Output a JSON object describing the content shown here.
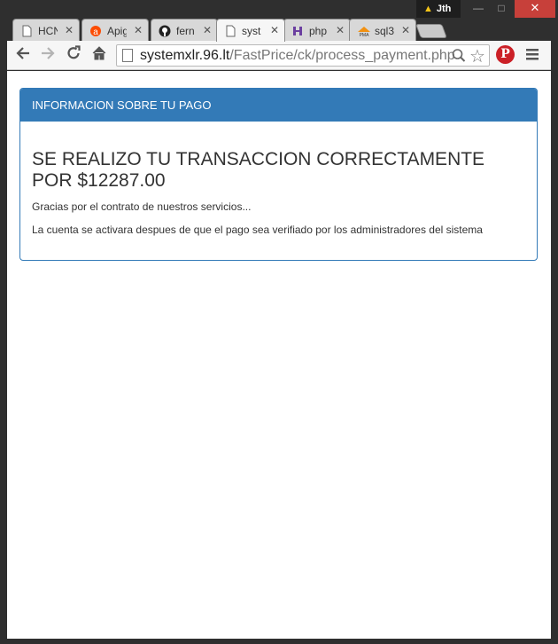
{
  "window": {
    "profile_name": "Jth",
    "min_label": "—",
    "max_label": "□",
    "close_label": "✕"
  },
  "tabs": [
    {
      "label": "HCN",
      "icon": "document-icon",
      "active": false
    },
    {
      "label": "Apig",
      "icon": "apigee-icon",
      "active": false
    },
    {
      "label": "fern",
      "icon": "github-icon",
      "active": false
    },
    {
      "label": "syst",
      "icon": "document-icon",
      "active": true
    },
    {
      "label": "php",
      "icon": "php-icon",
      "active": false
    },
    {
      "label": "sql3",
      "icon": "phpmyadmin-icon",
      "active": false
    }
  ],
  "tab_close": "✕",
  "toolbar": {
    "url_host": "systemxlr.96.lt",
    "url_path": "/FastPrice/ck/process_payment.php"
  },
  "panel": {
    "heading": "INFORMACION SOBRE TU PAGO",
    "title": "SE REALIZO TU TRANSACCION CORRECTAMENTE POR $12287.00",
    "thanks": "Gracias por el contrato de nuestros servicios...",
    "note": "La cuenta se activara despues de que el pago sea verifiado por los administradores del sistema"
  },
  "colors": {
    "panel_primary": "#337ab7",
    "window_close": "#c7403a",
    "pinterest": "#cb2027"
  }
}
